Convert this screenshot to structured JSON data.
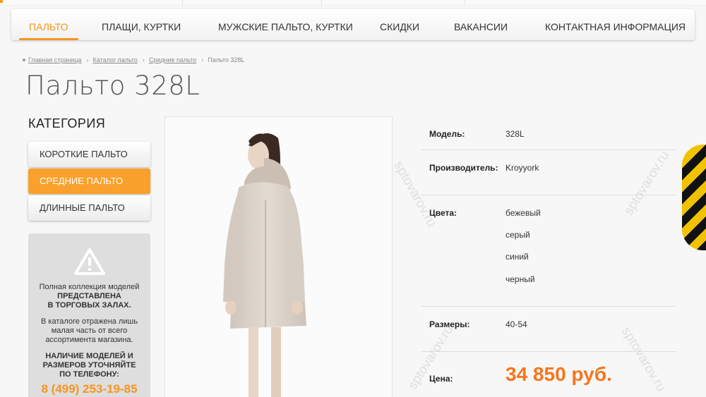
{
  "nav": {
    "items": [
      {
        "label": "ПАЛЬТО",
        "active": true
      },
      {
        "label": "ПЛАЩИ, КУРТКИ",
        "active": false
      },
      {
        "label": "МУЖСКИЕ ПАЛЬТО, КУРТКИ",
        "active": false
      },
      {
        "label": "СКИДКИ",
        "active": false
      },
      {
        "label": "ВАКАНСИИ",
        "active": false
      },
      {
        "label": "КОНТАКТНАЯ ИНФОРМАЦИЯ",
        "active": false
      }
    ]
  },
  "breadcrumb": {
    "items": [
      "Главная страница",
      "Каталог пальто",
      "Средние пальто"
    ],
    "current": "Пальто 328L"
  },
  "page_title": "Пальто 328L",
  "category": {
    "heading": "КАТЕГОРИЯ",
    "items": [
      {
        "label": "КОРОТКИЕ ПАЛЬТО",
        "active": false
      },
      {
        "label": "СРЕДНИЕ ПАЛЬТО",
        "active": true
      },
      {
        "label": "ДЛИННЫЕ ПАЛЬТО",
        "active": false
      }
    ]
  },
  "info_box": {
    "icon": "warning-icon",
    "line1": "Полная коллекция моделей",
    "line2": "ПРЕДСТАВЛЕНА",
    "line3": "В ТОРГОВЫХ ЗАЛАХ.",
    "line4": "В каталоге отражена лишь малая часть от всего ассортимента магазина.",
    "line5": "НАЛИЧИЕ МОДЕЛЕЙ И РАЗМЕРОВ УТОЧНЯЙТЕ ПО ТЕЛЕФОНУ:",
    "phone": "8 (499) 253-19-85"
  },
  "product": {
    "model_label": "Модель:",
    "model_value": "328L",
    "maker_label": "Производитель:",
    "maker_value": "Kroyyork",
    "colors_label": "Цвета:",
    "colors": [
      "бежевый",
      "серый",
      "синий",
      "черный"
    ],
    "sizes_label": "Размеры:",
    "sizes_value": "40-54",
    "price_label": "Цена:",
    "price_value": "34 850 руб."
  },
  "watermark": "sptovarov.ru",
  "colors": {
    "accent": "#f7941d",
    "price": "#f7761d",
    "background": "#f7f7f7"
  }
}
